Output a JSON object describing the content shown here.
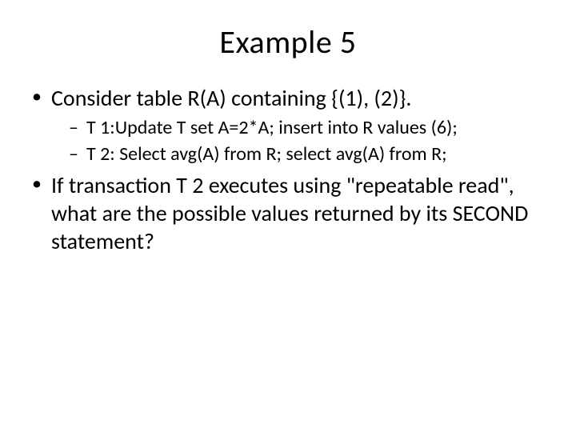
{
  "title": "Example 5",
  "bullets": [
    {
      "text": "Consider table R(A) containing {(1), (2)}.",
      "sub": [
        "T 1:Update T set A=2*A; insert into R values (6);",
        "T 2: Select avg(A) from R; select avg(A) from R;"
      ]
    },
    {
      "text": "If transaction T 2 executes using \"repeatable read\", what are the possible values returned by its SECOND statement?",
      "sub": []
    }
  ]
}
